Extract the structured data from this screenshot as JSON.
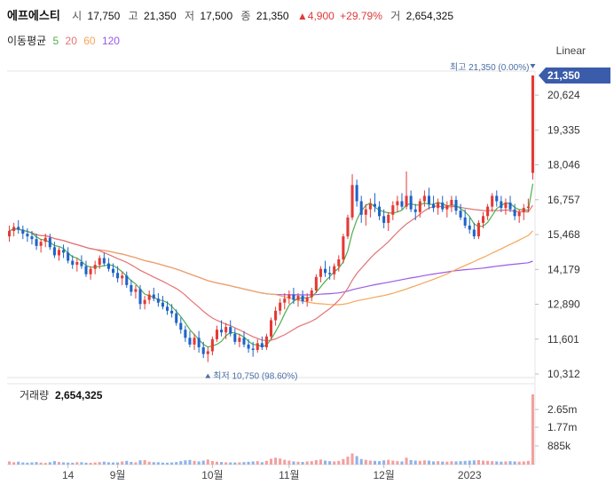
{
  "header": {
    "name": "에프에스티",
    "open_label": "시",
    "open": "17,750",
    "high_label": "고",
    "high": "21,350",
    "low_label": "저",
    "low": "17,500",
    "close_label": "종",
    "close": "21,350",
    "change": "▲4,900",
    "change_pct": "+29.79%",
    "volume_label": "거",
    "volume": "2,654,325"
  },
  "ma_legend": {
    "label": "이동평균",
    "items": [
      {
        "text": "5",
        "color": "#4caf50"
      },
      {
        "text": "20",
        "color": "#e57373"
      },
      {
        "text": "60",
        "color": "#f5a55a"
      },
      {
        "text": "120",
        "color": "#9b59e6"
      }
    ]
  },
  "scale_label": "Linear",
  "colors": {
    "up": "#e53935",
    "down": "#1e63c8",
    "ma5": "#4caf50",
    "ma20": "#e57373",
    "ma60": "#f5a55a",
    "ma120": "#9b59e6"
  },
  "chart_data": {
    "type": "candlestick",
    "price_ticks": [
      "21,350",
      "20,624",
      "19,335",
      "18,046",
      "16,757",
      "15,468",
      "14,179",
      "12,890",
      "11,601",
      "10,312"
    ],
    "price_ylim": [
      10312,
      21350
    ],
    "x_labels": [
      {
        "text": "14",
        "i": 13
      },
      {
        "text": "9월",
        "i": 24
      },
      {
        "text": "10월",
        "i": 45
      },
      {
        "text": "11월",
        "i": 62
      },
      {
        "text": "12월",
        "i": 83
      },
      {
        "text": "2023",
        "i": 102
      }
    ],
    "high_marker": {
      "text": "최고 21,350 (0.00%)",
      "price": 21350,
      "i": 116
    },
    "low_marker": {
      "text": "최저 10,750 (98.60%)",
      "price": 10750,
      "i": 44
    },
    "current_price": "21,350",
    "volume_title": "거래량",
    "volume_value": "2,654,325",
    "volume_ticks": [
      "2.65m",
      "1.77m",
      "885k"
    ],
    "volume_ylim": [
      0,
      2654325
    ],
    "candles": [
      [
        15400,
        15800,
        15200,
        15600
      ],
      [
        15600,
        15900,
        15400,
        15750
      ],
      [
        15750,
        16000,
        15500,
        15650
      ],
      [
        15650,
        15800,
        15300,
        15500
      ],
      [
        15500,
        15700,
        15200,
        15400
      ],
      [
        15400,
        15600,
        15100,
        15300
      ],
      [
        15300,
        15500,
        14900,
        15050
      ],
      [
        15050,
        15300,
        14800,
        15200
      ],
      [
        15200,
        15500,
        15000,
        15350
      ],
      [
        15350,
        15500,
        14900,
        15000
      ],
      [
        15000,
        15200,
        14600,
        14700
      ],
      [
        14700,
        15000,
        14500,
        14900
      ],
      [
        14900,
        15100,
        14600,
        14800
      ],
      [
        14800,
        15000,
        14400,
        14500
      ],
      [
        14500,
        14700,
        14200,
        14350
      ],
      [
        14350,
        14600,
        14100,
        14450
      ],
      [
        14450,
        14700,
        14200,
        14300
      ],
      [
        14300,
        14500,
        13900,
        14000
      ],
      [
        14000,
        14300,
        13800,
        14200
      ],
      [
        14200,
        14500,
        14000,
        14350
      ],
      [
        14350,
        14700,
        14200,
        14600
      ],
      [
        14600,
        14800,
        14300,
        14400
      ],
      [
        14400,
        14600,
        14100,
        14200
      ],
      [
        14200,
        14400,
        13900,
        14050
      ],
      [
        14050,
        14300,
        13700,
        13850
      ],
      [
        13850,
        14100,
        13600,
        13950
      ],
      [
        13950,
        14100,
        13500,
        13600
      ],
      [
        13600,
        13800,
        13200,
        13350
      ],
      [
        13350,
        13600,
        13100,
        13450
      ],
      [
        13450,
        13600,
        12700,
        12900
      ],
      [
        12900,
        13200,
        12700,
        13050
      ],
      [
        13050,
        13400,
        12900,
        13250
      ],
      [
        13250,
        13500,
        13000,
        13100
      ],
      [
        13100,
        13300,
        12800,
        12950
      ],
      [
        12950,
        13200,
        12700,
        12800
      ],
      [
        12800,
        13000,
        12500,
        12650
      ],
      [
        12650,
        12900,
        12400,
        12550
      ],
      [
        12550,
        12700,
        12100,
        12200
      ],
      [
        12200,
        12400,
        11800,
        11950
      ],
      [
        11950,
        12100,
        11500,
        11650
      ],
      [
        11650,
        11900,
        11300,
        11400
      ],
      [
        11400,
        11800,
        11200,
        11650
      ],
      [
        11650,
        11900,
        11100,
        11300
      ],
      [
        11300,
        11500,
        10900,
        11050
      ],
      [
        11050,
        11300,
        10750,
        11150
      ],
      [
        11150,
        11700,
        11000,
        11600
      ],
      [
        11600,
        12100,
        11500,
        11950
      ],
      [
        11950,
        12300,
        11700,
        11850
      ],
      [
        11850,
        12200,
        11600,
        12050
      ],
      [
        12050,
        12300,
        11700,
        11800
      ],
      [
        11800,
        12000,
        11400,
        11500
      ],
      [
        11500,
        11800,
        11300,
        11650
      ],
      [
        11650,
        11900,
        11300,
        11400
      ],
      [
        11400,
        11600,
        11100,
        11250
      ],
      [
        11250,
        11500,
        10950,
        11200
      ],
      [
        11200,
        11600,
        11100,
        11450
      ],
      [
        11450,
        11700,
        11200,
        11300
      ],
      [
        11300,
        11800,
        11200,
        11700
      ],
      [
        11700,
        12400,
        11600,
        12300
      ],
      [
        12300,
        12800,
        12100,
        12650
      ],
      [
        12650,
        13100,
        12500,
        12950
      ],
      [
        12950,
        13300,
        12700,
        13100
      ],
      [
        13100,
        13400,
        12900,
        13250
      ],
      [
        13250,
        13500,
        12900,
        13050
      ],
      [
        13050,
        13300,
        12800,
        13200
      ],
      [
        13200,
        13400,
        12900,
        13000
      ],
      [
        13000,
        13300,
        12800,
        13150
      ],
      [
        13150,
        13500,
        13000,
        13400
      ],
      [
        13400,
        14000,
        13300,
        13900
      ],
      [
        13900,
        14300,
        13700,
        14200
      ],
      [
        14200,
        14500,
        13900,
        14050
      ],
      [
        14050,
        14300,
        13800,
        14000
      ],
      [
        14000,
        14400,
        13800,
        14300
      ],
      [
        14300,
        14700,
        14100,
        14550
      ],
      [
        14550,
        15500,
        14400,
        15400
      ],
      [
        15400,
        16200,
        15300,
        16100
      ],
      [
        16100,
        17700,
        16000,
        17300
      ],
      [
        17300,
        17500,
        16500,
        16700
      ],
      [
        16700,
        16900,
        15900,
        16200
      ],
      [
        16200,
        16600,
        15800,
        16400
      ],
      [
        16400,
        16800,
        16100,
        16600
      ],
      [
        16600,
        17000,
        16300,
        16500
      ],
      [
        16500,
        16700,
        16000,
        16150
      ],
      [
        16150,
        16400,
        15700,
        15900
      ],
      [
        15900,
        16300,
        15600,
        16200
      ],
      [
        16200,
        16700,
        16000,
        16550
      ],
      [
        16550,
        16900,
        16300,
        16700
      ],
      [
        16700,
        17000,
        16400,
        16500
      ],
      [
        16500,
        17800,
        16400,
        16900
      ],
      [
        16900,
        17100,
        16300,
        16400
      ],
      [
        16400,
        16600,
        16000,
        16300
      ],
      [
        16300,
        16800,
        16100,
        16700
      ],
      [
        16700,
        17100,
        16500,
        16900
      ],
      [
        16900,
        17200,
        16400,
        16600
      ],
      [
        16600,
        16900,
        16300,
        16450
      ],
      [
        16450,
        16800,
        16200,
        16650
      ],
      [
        16650,
        16900,
        16300,
        16400
      ],
      [
        16400,
        16700,
        16100,
        16550
      ],
      [
        16550,
        16900,
        16300,
        16750
      ],
      [
        16750,
        16900,
        16200,
        16350
      ],
      [
        16350,
        16600,
        16000,
        16100
      ],
      [
        16100,
        16400,
        15700,
        15800
      ],
      [
        15800,
        16100,
        15500,
        15650
      ],
      [
        15650,
        15900,
        15300,
        15400
      ],
      [
        15400,
        16000,
        15300,
        15900
      ],
      [
        15900,
        16300,
        15700,
        16150
      ],
      [
        16150,
        16600,
        16000,
        16500
      ],
      [
        16500,
        17000,
        16300,
        16900
      ],
      [
        16900,
        17100,
        16500,
        16700
      ],
      [
        16700,
        16900,
        16300,
        16450
      ],
      [
        16450,
        16800,
        16200,
        16650
      ],
      [
        16650,
        16900,
        16300,
        16400
      ],
      [
        16400,
        16600,
        16000,
        16150
      ],
      [
        16150,
        16400,
        15900,
        16300
      ],
      [
        16300,
        16600,
        16000,
        16450
      ],
      [
        16450,
        16800,
        16300,
        16500
      ],
      [
        17750,
        21350,
        17500,
        21350
      ]
    ],
    "volumes": [
      1200,
      900,
      1100,
      800,
      700,
      850,
      950,
      760,
      640,
      900,
      1300,
      980,
      820,
      760,
      690,
      880,
      910,
      720,
      660,
      800,
      950,
      1100,
      870,
      780,
      820,
      1200,
      1400,
      1000,
      860,
      1600,
      1700,
      1100,
      920,
      880,
      760,
      700,
      820,
      950,
      1300,
      1600,
      1750,
      1400,
      1200,
      1500,
      1900,
      1350,
      1100,
      980,
      870,
      820,
      790,
      860,
      950,
      1050,
      1200,
      1300,
      900,
      1400,
      2200,
      2600,
      2300,
      1800,
      1500,
      1200,
      1100,
      1000,
      1200,
      1300,
      1700,
      1900,
      1500,
      1300,
      1200,
      1400,
      2100,
      3000,
      4200,
      3200,
      2100,
      1800,
      1500,
      1400,
      1300,
      1600,
      1800,
      1500,
      1300,
      1200,
      2600,
      1700,
      1500,
      1400,
      1600,
      1500,
      1200,
      1300,
      1150,
      1100,
      1250,
      1200,
      1300,
      1400,
      1500,
      1600,
      1700,
      1500,
      1400,
      1300,
      1200,
      1100,
      1200,
      1300,
      1200,
      1100,
      1200,
      1400,
      26543
    ]
  }
}
